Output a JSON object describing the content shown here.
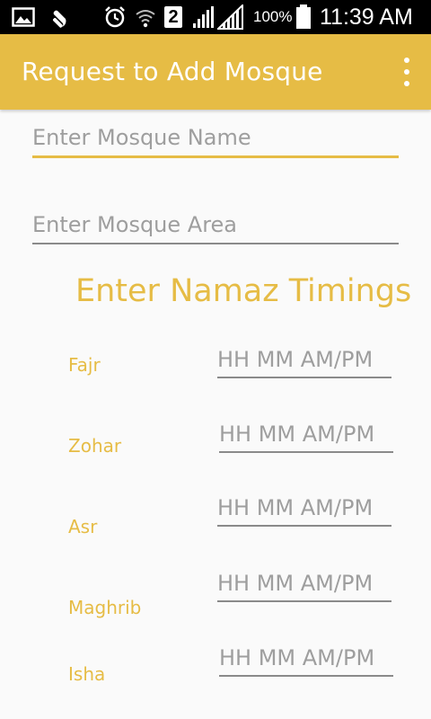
{
  "status_bar": {
    "battery_percent": "100%",
    "time": "11:39 AM",
    "sim_number": "2",
    "icons": [
      "image-icon",
      "wrench-icon",
      "alarm-icon",
      "wifi-icon",
      "sim-2-icon",
      "signal-icon",
      "signal-icon",
      "battery-icon"
    ]
  },
  "app_bar": {
    "title": "Request to Add Mosque",
    "menu_icon": "more-vert-icon"
  },
  "form": {
    "mosque_name_placeholder": "Enter Mosque Name",
    "mosque_area_placeholder": "Enter Mosque Area",
    "timings_heading": "Enter Namaz Timings",
    "time_placeholder": "HH MM AM/PM",
    "prayers": [
      {
        "label": "Fajr"
      },
      {
        "label": "Zohar"
      },
      {
        "label": "Asr"
      },
      {
        "label": "Maghrib"
      },
      {
        "label": "Isha"
      }
    ]
  },
  "colors": {
    "accent": "#e6bc45",
    "status_bar": "#000000",
    "background": "#fafafa"
  }
}
